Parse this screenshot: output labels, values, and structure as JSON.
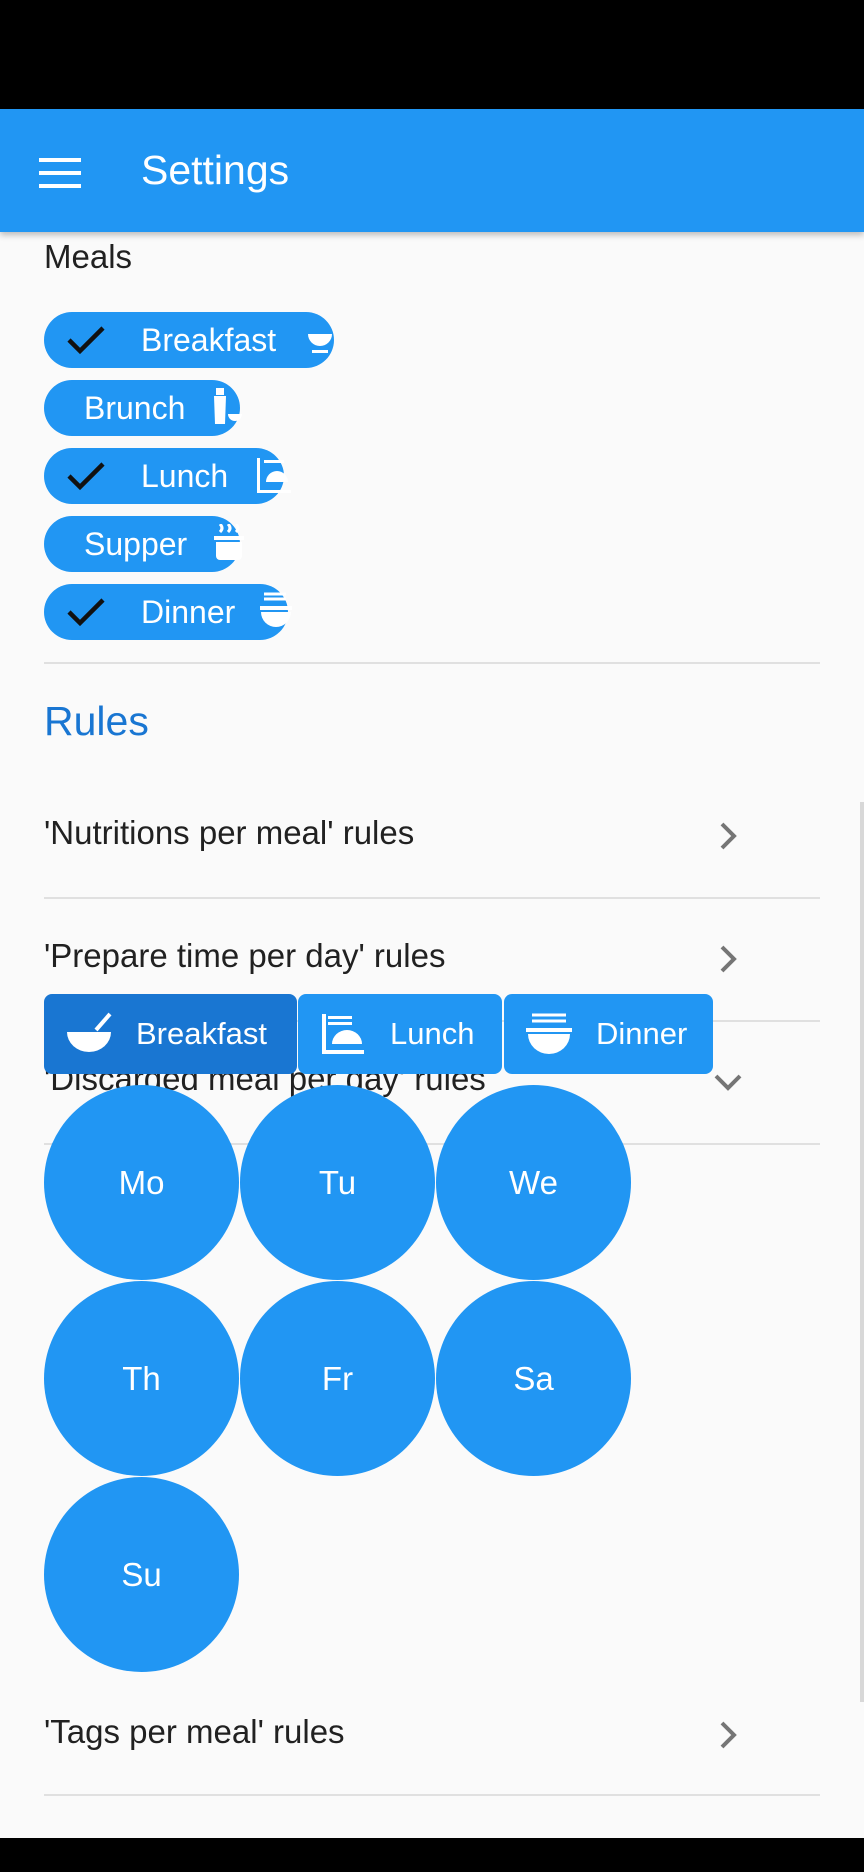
{
  "app_bar": {
    "title": "Settings",
    "menu_icon": "menu-icon",
    "color": "#2196F3"
  },
  "meals": {
    "label": "Meals",
    "chips": [
      {
        "label": "Breakfast",
        "selected": true,
        "icon": "breakfast-bowl-icon"
      },
      {
        "label": "Brunch",
        "selected": false,
        "icon": "bottle-icon"
      },
      {
        "label": "Lunch",
        "selected": true,
        "icon": "lunch-tray-icon"
      },
      {
        "label": "Supper",
        "selected": false,
        "icon": "hot-pot-icon"
      },
      {
        "label": "Dinner",
        "selected": true,
        "icon": "noodle-bowl-icon"
      }
    ]
  },
  "rules": {
    "heading": "Rules",
    "heading_color": "#1976D2",
    "items": [
      {
        "label": "'Nutritions per meal' rules",
        "chevron": "chevron-right-icon"
      },
      {
        "label": "'Prepare time per day' rules",
        "chevron": "chevron-right-icon"
      },
      {
        "label": "'Discarded meal per day' rules",
        "chevron": "chevron-down-icon"
      },
      {
        "label": "'Tags per meal' rules",
        "chevron": "chevron-right-icon"
      }
    ]
  },
  "meal_selector": {
    "buttons": [
      {
        "label": "Breakfast",
        "icon": "breakfast-bowl-icon",
        "active": true
      },
      {
        "label": "Lunch",
        "icon": "lunch-tray-icon",
        "active": false
      },
      {
        "label": "Dinner",
        "icon": "noodle-bowl-icon",
        "active": false
      }
    ]
  },
  "days": [
    "Mo",
    "Tu",
    "We",
    "Th",
    "Fr",
    "Sa",
    "Su"
  ]
}
